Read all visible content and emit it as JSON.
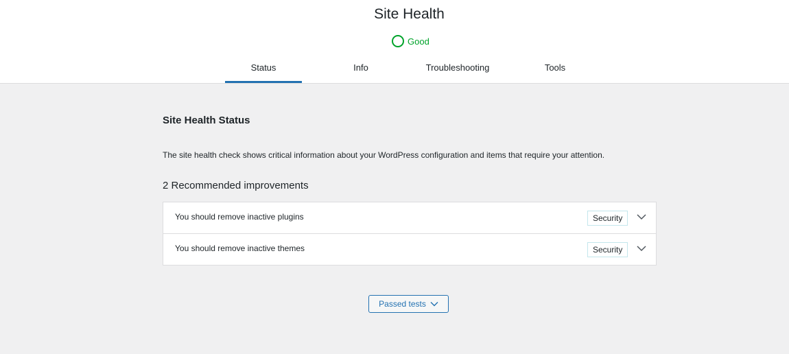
{
  "header": {
    "title": "Site Health",
    "status_label": "Good",
    "status_color": "#00a32a"
  },
  "tabs": [
    {
      "label": "Status",
      "active": true
    },
    {
      "label": "Info",
      "active": false
    },
    {
      "label": "Troubleshooting",
      "active": false
    },
    {
      "label": "Tools",
      "active": false
    }
  ],
  "main": {
    "title": "Site Health Status",
    "description": "The site health check shows critical information about your WordPress configuration and items that require your attention.",
    "improvements_heading": "2 Recommended improvements",
    "issues": [
      {
        "title": "You should remove inactive plugins",
        "badge": "Security",
        "icon": "chevron-down-icon"
      },
      {
        "title": "You should remove inactive themes",
        "badge": "Security",
        "icon": "chevron-down-icon"
      }
    ],
    "passed_tests_label": "Passed tests"
  },
  "colors": {
    "accent": "#2271b1",
    "good": "#00a32a",
    "badge_border": "#c3e6ec"
  }
}
